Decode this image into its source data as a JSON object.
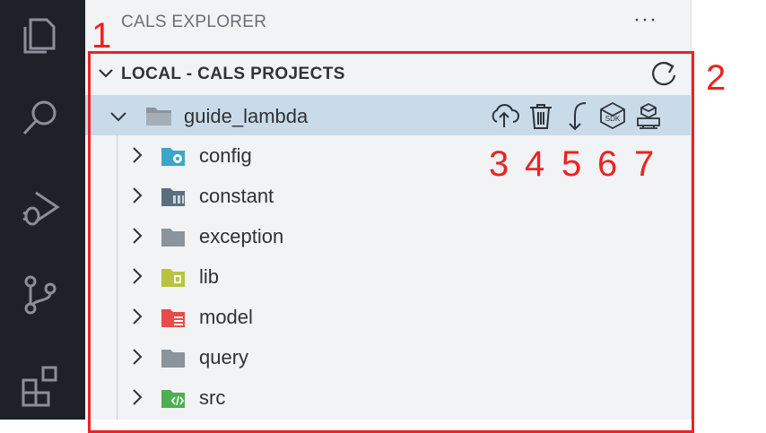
{
  "activity_bar": {
    "icons": [
      "explorer-icon",
      "search-icon",
      "run-debug-icon",
      "source-control-icon",
      "extensions-icon"
    ]
  },
  "explorer": {
    "title": "CALS EXPLORER",
    "more_label": "···"
  },
  "section": {
    "title": "LOCAL - CALS PROJECTS",
    "refresh_icon": "refresh-icon"
  },
  "project": {
    "name": "guide_lambda",
    "actions": [
      {
        "name": "upload-cloud-icon"
      },
      {
        "name": "trash-icon"
      },
      {
        "name": "download-arrow-icon"
      },
      {
        "name": "sdk-icon"
      },
      {
        "name": "deploy-icon"
      }
    ]
  },
  "folders": [
    {
      "name": "config",
      "color": "#3aa7c9",
      "kind": "gear"
    },
    {
      "name": "constant",
      "color": "#5b6e7d",
      "kind": "grid"
    },
    {
      "name": "exception",
      "color": "#8a949d",
      "kind": "plain"
    },
    {
      "name": "lib",
      "color": "#b9c43c",
      "kind": "book"
    },
    {
      "name": "model",
      "color": "#e94b4b",
      "kind": "lines"
    },
    {
      "name": "query",
      "color": "#8a949d",
      "kind": "plain"
    },
    {
      "name": "src",
      "color": "#4caf50",
      "kind": "code"
    }
  ],
  "annotations": {
    "a1": "1",
    "a2": "2",
    "a3": "3",
    "a4": "4",
    "a5": "5",
    "a6": "6",
    "a7": "7"
  },
  "colors": {
    "annotation": "#ee2222",
    "selection": "#c9dbe9"
  }
}
